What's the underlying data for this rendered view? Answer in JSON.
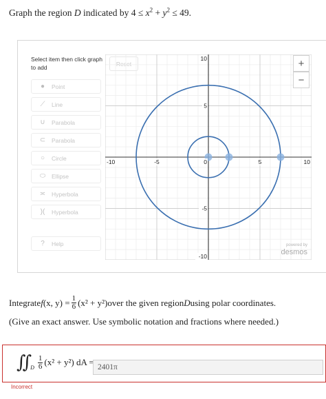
{
  "question": {
    "prefix": "Graph the region ",
    "region_var": "D",
    "middle": " indicated by 4 ≤ ",
    "x": "x",
    "plus": " + ",
    "y": "y",
    "suffix": " ≤ 49."
  },
  "widget": {
    "instruction": "Select item then click graph to add",
    "reset_label": "Reset",
    "zoom_in_label": "+",
    "zoom_out_label": "−",
    "tools": [
      {
        "label": "Point",
        "icon": "point-icon"
      },
      {
        "label": "Line",
        "icon": "line-icon"
      },
      {
        "label": "Parabola",
        "icon": "parabola-icon"
      },
      {
        "label": "Parabola",
        "icon": "sideways-parabola-icon"
      },
      {
        "label": "Circle",
        "icon": "circle-icon"
      },
      {
        "label": "Ellipse",
        "icon": "ellipse-icon"
      },
      {
        "label": "Hyperbola",
        "icon": "hyperbola-icon"
      },
      {
        "label": "Hyperbola",
        "icon": "sideways-hyperbola-icon"
      }
    ],
    "help_label": "Help",
    "powered_by": "powered by",
    "brand": "desmos"
  },
  "chart_data": {
    "type": "scatter",
    "xlim": [
      -10,
      10
    ],
    "ylim": [
      -10,
      10
    ],
    "grid": true,
    "x_ticks": [
      "-10",
      "-5",
      "0",
      "5",
      "10"
    ],
    "y_ticks": [
      "10",
      "5",
      "-5",
      "-10"
    ],
    "circles": [
      {
        "cx": 0,
        "cy": 0,
        "r": 2
      },
      {
        "cx": 0,
        "cy": 0,
        "r": 7
      }
    ],
    "points": [
      {
        "x": 0,
        "y": 0
      },
      {
        "x": 2,
        "y": 0
      },
      {
        "x": 7,
        "y": 0
      }
    ],
    "curve_color": "#3a6fb0",
    "point_color": "#89b1e0"
  },
  "integrate": {
    "prefix": "Integrate ",
    "f": "f",
    "args": "(x, y) = ",
    "num": "1",
    "den": "6",
    "expr": "(x² + y²)",
    "middle": " over the given region ",
    "region_var": "D",
    "suffix": " using polar coordinates."
  },
  "note": "(Give an exact answer. Use symbolic notation and fractions where needed.)",
  "answer": {
    "integral_symbol": "∬",
    "subscript": "D",
    "num": "1",
    "den": "6",
    "expr": "(x² + y²) dA =",
    "value": "2401π",
    "status": "Incorrect"
  }
}
